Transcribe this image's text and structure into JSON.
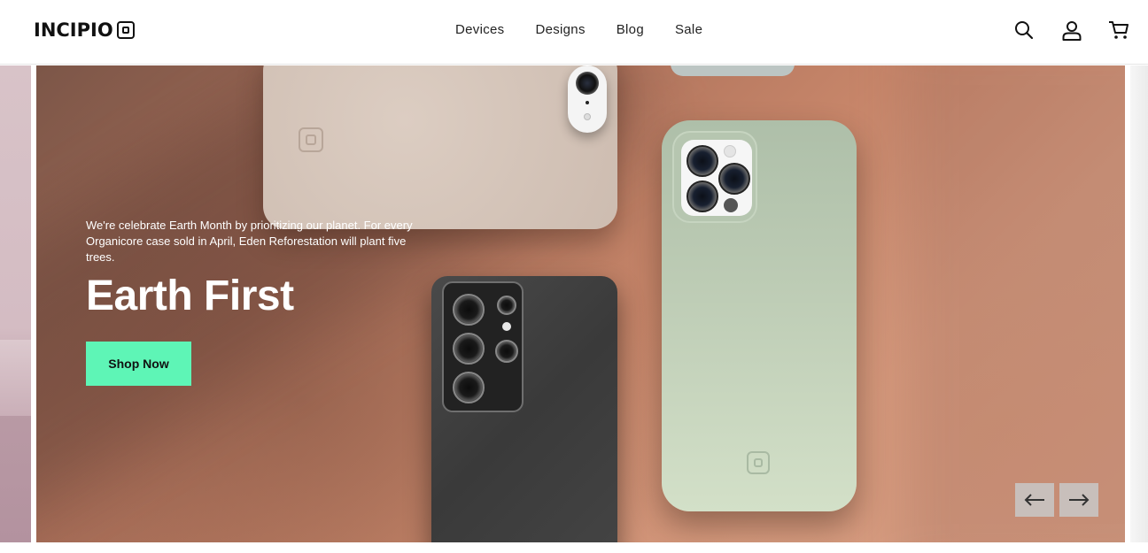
{
  "brand": {
    "logo_text": "INCIPIO"
  },
  "nav": {
    "items": [
      "Devices",
      "Designs",
      "Blog",
      "Sale"
    ]
  },
  "header_icons": [
    "search-icon",
    "account-icon",
    "cart-icon"
  ],
  "hero": {
    "blurb": "We're celebrate Earth Month by prioritizing our planet. For every Organicore case sold in April, Eden Reforestation will plant five trees.",
    "title": "Earth First",
    "cta_label": "Shop Now",
    "cta_color": "#5ef5b6",
    "controls": [
      "arrow-left-icon",
      "arrow-right-icon"
    ]
  },
  "colors": {
    "text_dark": "#111111",
    "text_light": "#ffffff",
    "accent": "#5ef5b6"
  }
}
